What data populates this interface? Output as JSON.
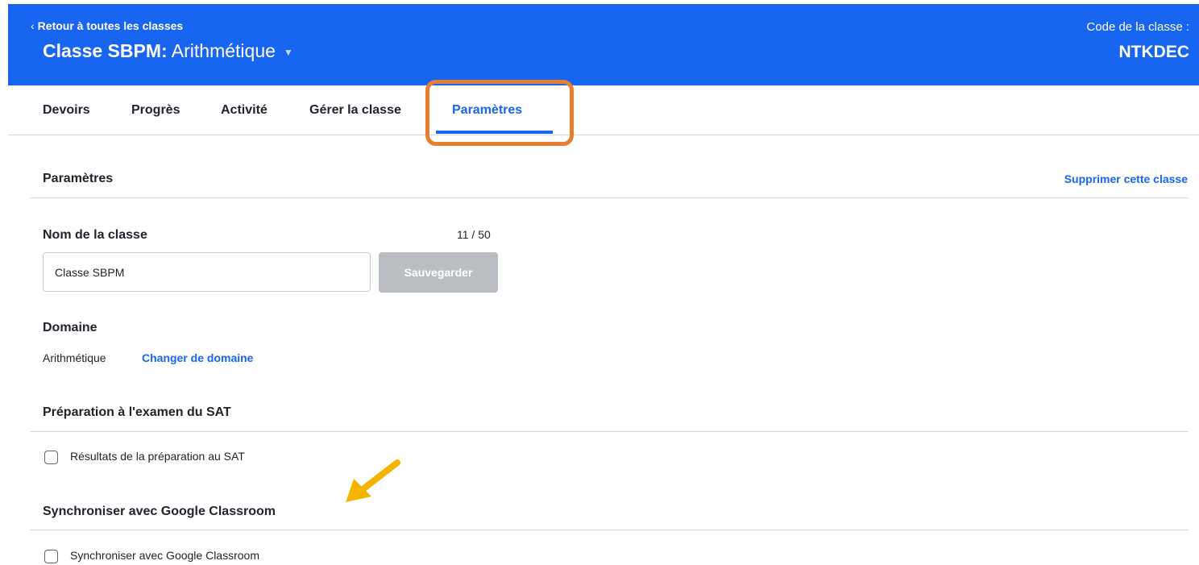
{
  "header": {
    "back_link": "Retour à toutes les classes",
    "class_name_bold": "Classe SBPM:",
    "class_name_rest": " Arithmétique",
    "code_label": "Code de la classe :",
    "code_value": "NTKDEC",
    "background_color": "#1865f2"
  },
  "tabs": [
    {
      "label": "Devoirs"
    },
    {
      "label": "Progrès"
    },
    {
      "label": "Activité"
    },
    {
      "label": "Gérer la classe"
    },
    {
      "label": "Paramètres",
      "active": true
    }
  ],
  "settings": {
    "title": "Paramètres",
    "delete_link": "Supprimer cette classe",
    "class_name": {
      "label": "Nom de la classe",
      "counter": "11 / 50",
      "value": "Classe SBPM",
      "save_label": "Sauvegarder"
    },
    "domain": {
      "label": "Domaine",
      "value": "Arithmétique",
      "change_link": "Changer de domaine"
    },
    "sat": {
      "title": "Préparation à l'examen du SAT",
      "checkbox_label": "Résultats de la préparation au SAT",
      "checked": false
    },
    "google": {
      "title": "Synchroniser avec Google Classroom",
      "checkbox_label": "Synchroniser avec Google Classroom",
      "checked": false
    }
  },
  "annotations": {
    "highlight_color": "#e87f2f",
    "arrow_color": "#f5b400"
  },
  "colors": {
    "accent": "#1865f2",
    "disabled_button": "#babec2",
    "text": "#21242c"
  },
  "icons": {
    "back": "chevron-left-icon",
    "title_dropdown": "caret-down-icon",
    "annotation_arrow": "arrow-icon"
  }
}
